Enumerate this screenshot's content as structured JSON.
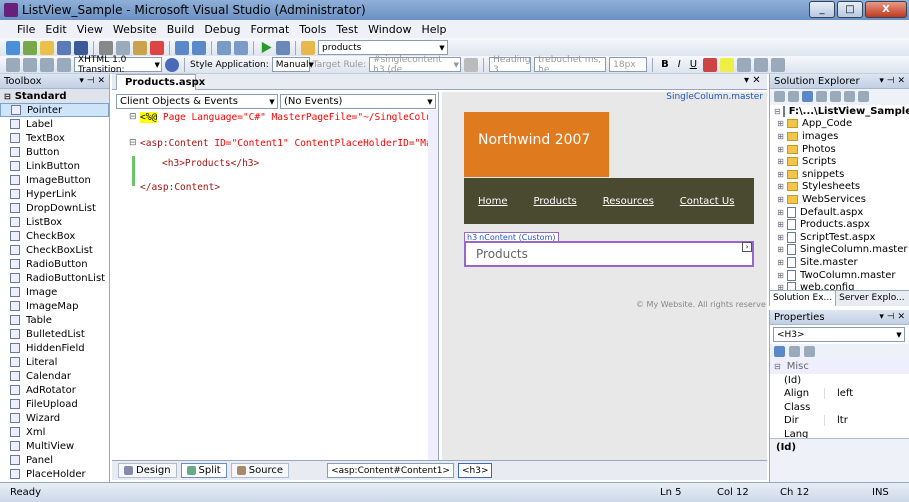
{
  "window": {
    "title": "ListView_Sample - Microsoft Visual Studio (Administrator)",
    "minimize": "_",
    "maximize": "□",
    "close": "X"
  },
  "menu": [
    "File",
    "Edit",
    "View",
    "Website",
    "Build",
    "Debug",
    "Format",
    "Tools",
    "Test",
    "Window",
    "Help"
  ],
  "toolbar1": {
    "find_value": "products"
  },
  "toolbar2": {
    "doctype": "XHTML 1.0 Transition:",
    "style_app_label": "Style Application:",
    "style_app_value": "Manual",
    "target_rule_label": "Target Rule:",
    "target_rule_value": "#singlecontent h3 (de",
    "block_format": "Heading 3",
    "font": "trebuchet ms, he",
    "size": "18px",
    "bold": "B",
    "italic": "I",
    "underline": "U"
  },
  "toolbox": {
    "title": "Toolbox",
    "group": "Standard",
    "items": [
      "Pointer",
      "Label",
      "TextBox",
      "Button",
      "LinkButton",
      "ImageButton",
      "HyperLink",
      "DropDownList",
      "ListBox",
      "CheckBox",
      "CheckBoxList",
      "RadioButton",
      "RadioButtonList",
      "Image",
      "ImageMap",
      "Table",
      "BulletedList",
      "HiddenField",
      "Literal",
      "Calendar",
      "AdRotator",
      "FileUpload",
      "Wizard",
      "Xml",
      "MultiView",
      "Panel",
      "PlaceHolder"
    ]
  },
  "editor": {
    "tab": "Products.aspx",
    "objects_combo": "Client Objects & Events",
    "events_combo": "(No Events)",
    "code": {
      "l1_a": "<%@",
      "l1_b": " Page Language=\"C#\" MasterPageFile=\"~/SingleColu",
      "l2_a": "<asp:Content",
      "l2_b": " ID=\"Content1\"",
      "l2_c": " ContentPlaceHolderID=\"Ma",
      "l3": "<h3>Products</h3>",
      "l4": "</asp:Content>"
    }
  },
  "design": {
    "master_label": "SingleColumn.master",
    "site_title": "Northwind 2007",
    "nav": [
      "Home",
      "Products",
      "Resources",
      "Contact Us"
    ],
    "content_tag": "h3",
    "content_label": "nContent (Custom)",
    "heading": "Products",
    "footer": "© My Website. All rights reserve"
  },
  "views": {
    "design": "Design",
    "split": "Split",
    "source": "Source",
    "crumb1": "<asp:Content#Content1>",
    "crumb2": "<h3>"
  },
  "solution_explorer": {
    "title": "Solution Explorer",
    "root": "F:\\...\\ListView_Sample\\",
    "items": [
      {
        "name": "App_Code",
        "type": "folder"
      },
      {
        "name": "images",
        "type": "folder"
      },
      {
        "name": "Photos",
        "type": "folder"
      },
      {
        "name": "Scripts",
        "type": "folder"
      },
      {
        "name": "snippets",
        "type": "folder"
      },
      {
        "name": "Stylesheets",
        "type": "folder"
      },
      {
        "name": "WebServices",
        "type": "folder"
      },
      {
        "name": "Default.aspx",
        "type": "file"
      },
      {
        "name": "Products.aspx",
        "type": "file"
      },
      {
        "name": "ScriptTest.aspx",
        "type": "file"
      },
      {
        "name": "SingleColumn.master",
        "type": "file"
      },
      {
        "name": "Site.master",
        "type": "file"
      },
      {
        "name": "TwoColumn.master",
        "type": "file"
      },
      {
        "name": "web.config",
        "type": "file"
      }
    ],
    "tab1": "Solution Ex...",
    "tab2": "Server Explo..."
  },
  "properties": {
    "title": "Properties",
    "object": "<H3>",
    "category": "Misc",
    "rows": [
      {
        "name": "(Id)",
        "value": ""
      },
      {
        "name": "Align",
        "value": "left"
      },
      {
        "name": "Class",
        "value": ""
      },
      {
        "name": "Dir",
        "value": "ltr"
      },
      {
        "name": "Lang",
        "value": ""
      }
    ],
    "desc": "(Id)"
  },
  "status": {
    "ready": "Ready",
    "ln": "Ln 5",
    "col": "Col 12",
    "ch": "Ch 12",
    "ins": "INS"
  },
  "colors": {
    "orange": "#e07a1e",
    "olive": "#4a4a30",
    "purple": "#9966cc"
  }
}
